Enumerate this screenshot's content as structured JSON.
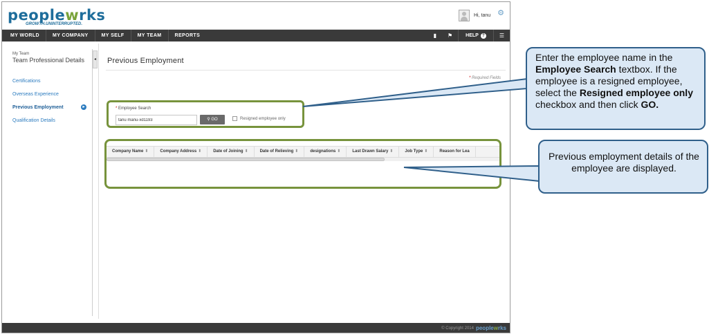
{
  "header": {
    "logo_main": "peopleworks",
    "logo_prefix": "pe",
    "logo_o": "o",
    "logo_middle": "ple",
    "logo_w": "w",
    "logo_suffix": "rks",
    "logo_tagline": "GROWTH.UNINTERRUPTED.",
    "greeting": "Hi, tanu",
    "settings_icon": "gear-icon"
  },
  "nav": {
    "items": [
      "MY WORLD",
      "MY COMPANY",
      "MY SELF",
      "MY TEAM",
      "REPORTS"
    ],
    "help_label": "HELP",
    "icons": [
      "book-icon",
      "flag-icon",
      "help-icon",
      "menu-icon"
    ]
  },
  "sidebar": {
    "subtitle": "My Team",
    "title": "Team Professional Details",
    "items": [
      {
        "label": "Certifications",
        "active": false
      },
      {
        "label": "Overseas Experience",
        "active": false
      },
      {
        "label": "Previous Employment",
        "active": true
      },
      {
        "label": "Qualification Details",
        "active": false
      }
    ]
  },
  "main": {
    "title": "Previous Employment",
    "required_note": "Required Fields",
    "search": {
      "label": "Employee Search",
      "value": "tanu manu-xd1193",
      "go_label": "GO",
      "resigned_label": "Resigned employee only",
      "resigned_checked": false
    },
    "table": {
      "columns": [
        "Company Name",
        "Company Address",
        "Date of Joining",
        "Date of Relieving",
        "designations",
        "Last Drawn Salary",
        "Job Type",
        "Reason for Lea"
      ],
      "rows": []
    }
  },
  "footer": {
    "copyright": "© Copyright 2014",
    "logo_prefix": "pe",
    "logo_o": "o",
    "logo_middle": "ple",
    "logo_w": "w",
    "logo_suffix": "rks"
  },
  "callouts": {
    "search": {
      "t1": "Enter the employee name in the ",
      "b1": "Employee Search",
      "t2": " textbox.  If the employee is a resigned employee, select the ",
      "b2": "Resigned employee only",
      "t3": " checkbox and then click ",
      "b3": "GO."
    },
    "table": {
      "text": "Previous employment  details of the employee are displayed."
    }
  },
  "colors": {
    "brand_blue": "#1e6d9b",
    "brand_green": "#7aa33a",
    "nav_bg": "#3a3a3a",
    "highlight_border": "#77933c",
    "callout_bg": "#dbe8f5",
    "callout_border": "#2f5f8a"
  }
}
